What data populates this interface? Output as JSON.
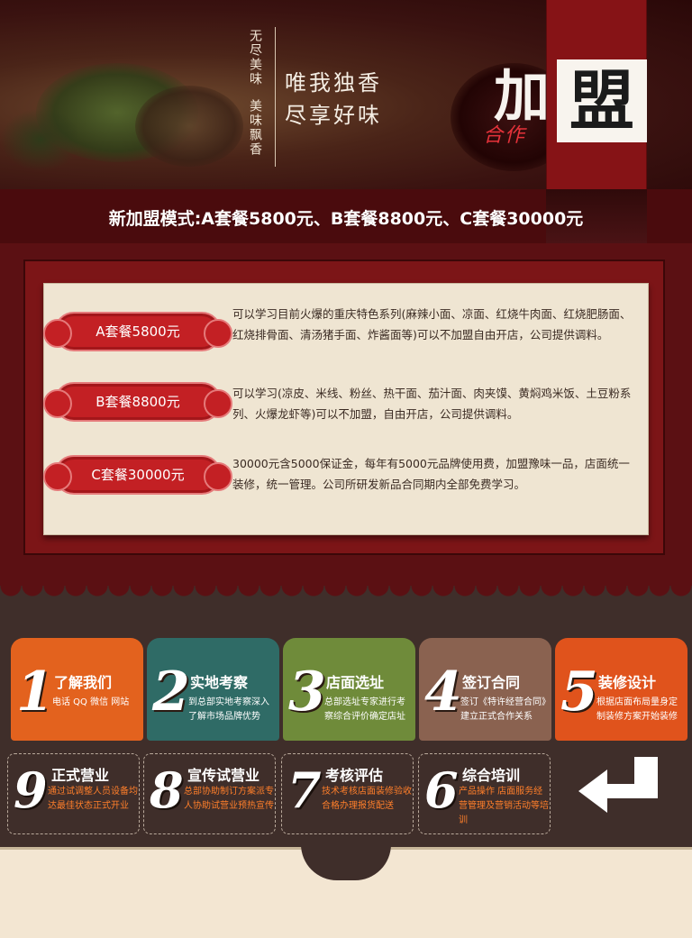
{
  "banner": {
    "vertical_left": "无尽美味",
    "vertical_right": "美味飘香",
    "slogan_line1": "唯我独香",
    "slogan_line2": "尽享好味",
    "logo_jia": "加",
    "logo_meng": "盟",
    "logo_hezuo": "合作"
  },
  "headline": "新加盟模式:A套餐5800元、B套餐8800元、C套餐30000元",
  "packages": [
    {
      "label": "A套餐5800元",
      "desc": "可以学习目前火爆的重庆特色系列(麻辣小面、凉面、红烧牛肉面、红烧肥肠面、红烧排骨面、清汤猪手面、炸酱面等)可以不加盟自由开店，公司提供调料。"
    },
    {
      "label": "B套餐8800元",
      "desc": "可以学习(凉皮、米线、粉丝、热干面、茄汁面、肉夹馍、黄焖鸡米饭、土豆粉系列、火爆龙虾等)可以不加盟，自由开店，公司提供调料。"
    },
    {
      "label": "C套餐30000元",
      "desc": "30000元含5000保证金，每年有5000元品牌使用费，加盟豫味一品，店面统一装修，统一管理。公司所研发新品合同期内全部免费学习。"
    }
  ],
  "steps_top": [
    {
      "num": "1",
      "title": "了解我们",
      "desc": "电话 QQ 微信 网站"
    },
    {
      "num": "2",
      "title": "实地考察",
      "desc": "到总部实地考察深入了解市场品牌优势"
    },
    {
      "num": "3",
      "title": "店面选址",
      "desc": "总部选址专家进行考察综合评价确定店址"
    },
    {
      "num": "4",
      "title": "签订合同",
      "desc": "签订《特许经营合同》建立正式合作关系"
    },
    {
      "num": "5",
      "title": "装修设计",
      "desc": "根据店面布局量身定制装修方案开始装修"
    }
  ],
  "steps_bottom": [
    {
      "num": "9",
      "title": "正式营业",
      "desc": "通过试调整人员设备均达最佳状态正式开业"
    },
    {
      "num": "8",
      "title": "宣传试营业",
      "desc": "总部协助制订方案派专人协助试营业预热宣传"
    },
    {
      "num": "7",
      "title": "考核评估",
      "desc": "技术考核店面装修验收合格办理报货配送"
    },
    {
      "num": "6",
      "title": "综合培训",
      "desc": "产品操作 店面服务经营管理及营销活动等培训"
    }
  ],
  "colors": {
    "banner_red": "#861316",
    "badge_red": "#c32024",
    "step1": "#e3621e",
    "step2": "#2f6b66",
    "step3": "#6f8b3a",
    "step4": "#8a6250",
    "step5": "#e0531c",
    "accent_orange": "#ff7f2a"
  }
}
